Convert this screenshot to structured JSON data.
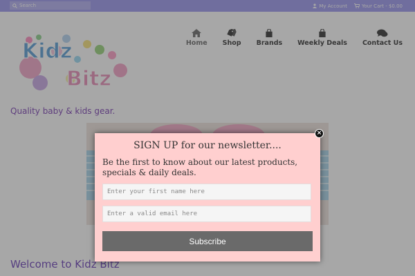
{
  "topbar": {
    "search_placeholder": "Search",
    "account_label": "My Account",
    "cart_label": "Your Cart - $0.00"
  },
  "logo": {
    "line1": "Kidz",
    "line2": "Bitz"
  },
  "nav": {
    "items": [
      {
        "label": "Home",
        "icon": "home-icon"
      },
      {
        "label": "Shop",
        "icon": "tag-icon"
      },
      {
        "label": "Brands",
        "icon": "bag-icon"
      },
      {
        "label": "Weekly Deals",
        "icon": "bag-icon"
      },
      {
        "label": "Contact Us",
        "icon": "chat-icon"
      }
    ]
  },
  "tagline": "Quality baby & kids gear.",
  "welcome": "Welcome to Kidz Bitz",
  "modal": {
    "title": "SIGN UP for our newsletter....",
    "description": "Be the first to know about our latest products, specials & daily deals.",
    "first_name_placeholder": "Enter your first name here",
    "email_placeholder": "Enter a valid email here",
    "subscribe_label": "Subscribe",
    "close_symbol": "×"
  },
  "colors": {
    "topbar": "#9b97ee",
    "modal_bg": "#ffcfcf",
    "button_bg": "#6a6a6a",
    "tagline": "#7a3fb3"
  }
}
